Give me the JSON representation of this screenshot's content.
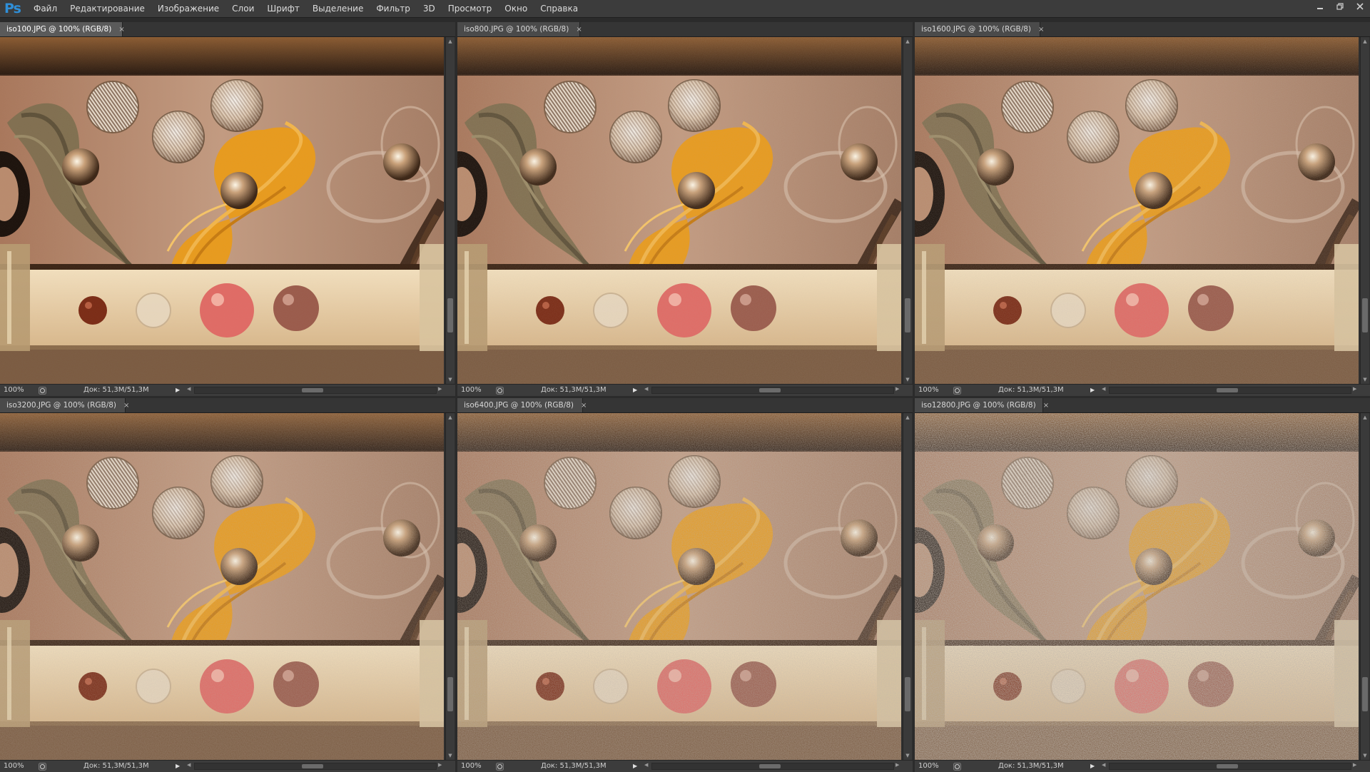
{
  "app": {
    "logo": "Ps",
    "menu": [
      "Файл",
      "Редактирование",
      "Изображение",
      "Слои",
      "Шрифт",
      "Выделение",
      "Фильтр",
      "3D",
      "Просмотр",
      "Окно",
      "Справка"
    ]
  },
  "window_controls": {
    "minimize_icon": "minimize-icon",
    "restore_icon": "restore-icon",
    "close_icon": "close-icon"
  },
  "documents": [
    {
      "tab": "iso100.JPG @ 100% (RGB/8)",
      "zoom": "100%",
      "doc_info": "Док: 51,3M/51,3M",
      "close": "×",
      "noise": 0.02,
      "active": true
    },
    {
      "tab": "iso800.JPG @ 100% (RGB/8)",
      "zoom": "100%",
      "doc_info": "Док: 51,3M/51,3M",
      "close": "×",
      "noise": 0.05,
      "active": false
    },
    {
      "tab": "iso1600.JPG @ 100% (RGB/8)",
      "zoom": "100%",
      "doc_info": "Док: 51,3M/51,3M",
      "close": "×",
      "noise": 0.08,
      "active": false
    },
    {
      "tab": "iso3200.JPG @ 100% (RGB/8)",
      "zoom": "100%",
      "doc_info": "Док: 51,3M/51,3M",
      "close": "×",
      "noise": 0.12,
      "active": false
    },
    {
      "tab": "iso6400.JPG @ 100% (RGB/8)",
      "zoom": "100%",
      "doc_info": "Док: 51,3M/51,3M",
      "close": "×",
      "noise": 0.2,
      "active": false
    },
    {
      "tab": "iso12800.JPG @ 100% (RGB/8)",
      "zoom": "100%",
      "doc_info": "Док: 51,3M/51,3M",
      "close": "×",
      "noise": 0.32,
      "active": false
    }
  ],
  "colors": {
    "menubar": "#3c3c3c",
    "logo": "#2f8fd8",
    "wall": "#b98a6c",
    "wall_dark": "#2a1a10",
    "orange_thread": "#e89a1c",
    "olive_thread": "#7d6e4e",
    "shelf": "#ead2a8",
    "shelf_dark": "#3a2314"
  }
}
